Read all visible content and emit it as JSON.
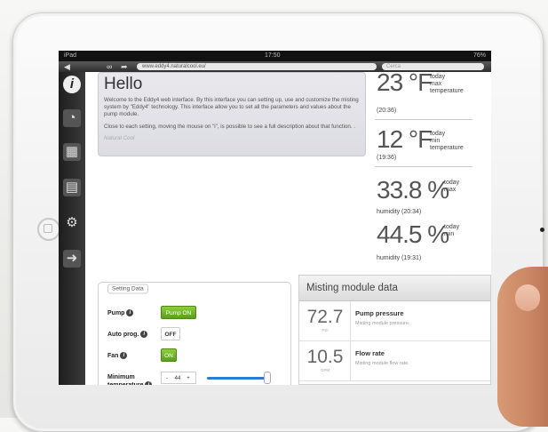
{
  "statusbar": {
    "left": "iPad",
    "time": "17:50",
    "battery": "76%"
  },
  "browser": {
    "url": "www.eddy4.naturalcool.eu/",
    "search_placeholder": "Cerca"
  },
  "sidebar": {
    "icons": [
      "info-icon",
      "gauge-icon",
      "calendar-icon",
      "chart-icon",
      "settings-gears-icon",
      "logout-icon"
    ]
  },
  "hello": {
    "title": "Hello",
    "p1": "Welcome to the Eddy4 web interface. By this interface you can setting up, use and customize the misting system by \"Eddy4\" technology. This interface allow you to set all the parameters and values about the pump module.",
    "p2": "Close to each setting, moving the mouse on \"i\", is possible to see a full description about that function. .",
    "signature": "Natural Cool"
  },
  "stats": [
    {
      "value": "23 °F",
      "side": [
        "today",
        "max",
        "temperature"
      ],
      "sub": "(20:36)"
    },
    {
      "value": "12 °F",
      "side": [
        "today",
        "min",
        "temperature"
      ],
      "sub": "(19:36)"
    },
    {
      "value": "33.8 %",
      "side": [
        "today",
        "max"
      ],
      "sub": "humidity (20:34)"
    },
    {
      "value": "44.5 %",
      "side": [
        "today",
        "min"
      ],
      "sub": "humidity (19:31)"
    }
  ],
  "settings": {
    "legend": "Setting Data",
    "pump_label": "Pump",
    "pump_value": "Pump ON",
    "autoprog_label": "Auto prog.",
    "autoprog_value": "OFF",
    "fan_label": "Fan",
    "fan_value": "ON",
    "mintemp_label_1": "Minimum",
    "mintemp_label_2": "temperature",
    "mintemp_value": "44",
    "slider_fraction": 0.92
  },
  "misting": {
    "title": "Misting module data",
    "rows": [
      {
        "value": "72.7",
        "unit": "PSI",
        "title": "Pump pressure",
        "desc": "Misting module pressure."
      },
      {
        "value": "10.5",
        "unit": "GPM",
        "title": "Flow rate",
        "desc": "Misting module flow rate."
      }
    ]
  },
  "colors": {
    "accent_green": "#6bb42a",
    "slider_blue": "#2c7bd6"
  }
}
